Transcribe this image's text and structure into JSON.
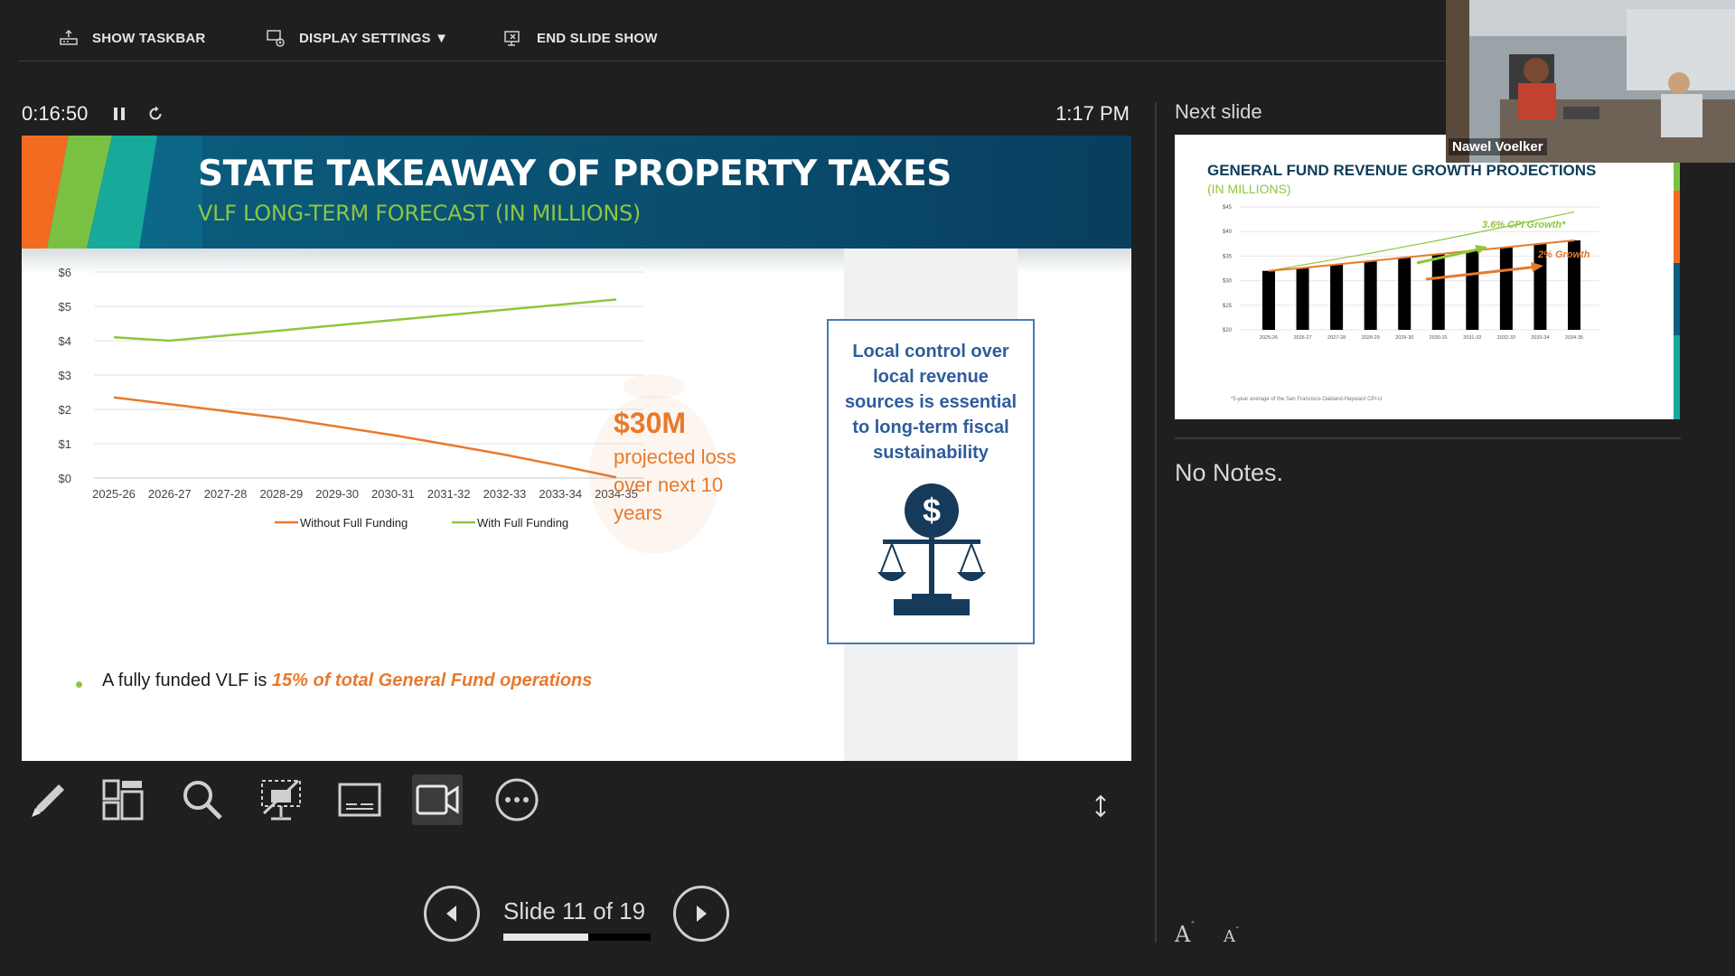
{
  "toolbar": {
    "show_taskbar": "SHOW TASKBAR",
    "display_settings": "DISPLAY SETTINGS ▼",
    "end_slide_show": "END SLIDE SHOW"
  },
  "timer": {
    "elapsed": "0:16:50",
    "clock": "1:17 PM"
  },
  "slide": {
    "title": "STATE TAKEAWAY OF PROPERTY TAXES",
    "subtitle": "VLF LONG-TERM FORECAST (IN MILLIONS)",
    "annotation_amount": "$30M",
    "annotation_desc": "projected loss over next 10 years",
    "callout": "Local control over local revenue sources is essential to long-term fiscal sustainability",
    "bullet_prefix": "A fully funded VLF is ",
    "bullet_emphasis": "15% of total General Fund operations",
    "colors": {
      "header": "#0b5f80",
      "green": "#8dc63f",
      "orange": "#e8792b",
      "callout_blue": "#2e5d9b"
    }
  },
  "chart_data": {
    "type": "line",
    "categories": [
      "2025-26",
      "2026-27",
      "2027-28",
      "2028-29",
      "2029-30",
      "2030-31",
      "2031-32",
      "2032-33",
      "2033-34",
      "2034-35"
    ],
    "y_tick_labels": [
      "$0",
      "$1",
      "$2",
      "$3",
      "$4",
      "$5",
      "$6"
    ],
    "ylim": [
      0,
      6
    ],
    "grid": true,
    "legend_position": "bottom",
    "series": [
      {
        "name": "Without Full Funding",
        "color": "#e8792b",
        "values": [
          2.35,
          2.15,
          1.95,
          1.75,
          1.5,
          1.25,
          0.97,
          0.68,
          0.36,
          0.02
        ]
      },
      {
        "name": "With Full Funding",
        "color": "#8dc63f",
        "values": [
          4.1,
          4.0,
          4.15,
          4.3,
          4.45,
          4.6,
          4.75,
          4.9,
          5.05,
          5.2
        ]
      }
    ]
  },
  "tools": [
    "pen-icon",
    "see-all-slides-icon",
    "zoom-icon",
    "black-screen-icon",
    "subtitles-icon",
    "camera-icon",
    "more-options-icon"
  ],
  "navigation": {
    "counter": "Slide 11 of 19",
    "current": 11,
    "total": 19
  },
  "next_slide": {
    "label": "Next slide",
    "title": "GENERAL FUND REVENUE GROWTH PROJECTIONS",
    "subtitle": "(IN MILLIONS)",
    "footnote": "*5-year average of the San Francisco-Oakland-Hayward CPI-U",
    "annotation_cpi": "3.6% CPI Growth*",
    "annotation_growth": "2% Growth"
  },
  "next_slide_chart": {
    "type": "bar",
    "categories": [
      "2025-26",
      "2026-27",
      "2027-28",
      "2028-29",
      "2029-30",
      "2030-31",
      "2031-32",
      "2032-33",
      "2033-34",
      "2034-35"
    ],
    "y_tick_labels": [
      "$20",
      "$25",
      "$30",
      "$35",
      "$40",
      "$45"
    ],
    "ylim": [
      20,
      45
    ],
    "values": [
      32,
      32.6,
      33.3,
      34,
      34.7,
      35.4,
      36.1,
      36.8,
      37.5,
      38.2
    ],
    "cpi_line": [
      32,
      33.2,
      34.4,
      35.6,
      36.9,
      38.2,
      39.6,
      41.0,
      42.5,
      44.0
    ],
    "growth_line": [
      32,
      32.6,
      33.3,
      34,
      34.7,
      35.4,
      36.1,
      36.8,
      37.5,
      38.2
    ]
  },
  "notes": {
    "text": "No Notes."
  },
  "video": {
    "participant": "Nawel Voelker"
  }
}
